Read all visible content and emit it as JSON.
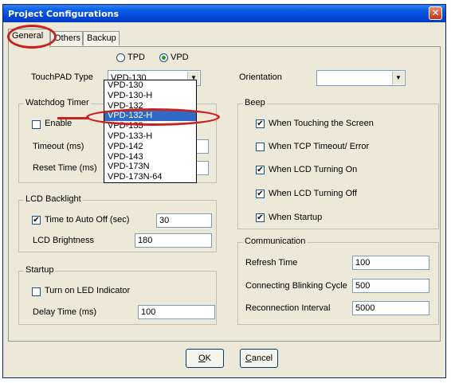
{
  "window": {
    "title": "Project Configurations",
    "close_glyph": "✕"
  },
  "tabs": [
    {
      "label": "General"
    },
    {
      "label": "Others"
    },
    {
      "label": "Backup"
    }
  ],
  "touchpad": {
    "type_label": "TouchPAD Type",
    "radio_tpd": "TPD",
    "radio_vpd": "VPD",
    "selected_radio": "VPD",
    "combo_value": "VPD-130",
    "dropdown_items": [
      "VPD-130",
      "VPD-130-H",
      "VPD-132",
      "VPD-132-H",
      "VPD-133",
      "VPD-133-H",
      "VPD-142",
      "VPD-143",
      "VPD-173N",
      "VPD-173N-64"
    ],
    "highlighted_item": "VPD-132-H"
  },
  "orientation": {
    "label": "Orientation",
    "value": ""
  },
  "watchdog": {
    "title": "Watchdog Timer",
    "enable_label": "Enable",
    "timeout_label": "Timeout (ms)",
    "reset_label": "Reset Time (ms)"
  },
  "backlight": {
    "title": "LCD Backlight",
    "auto_off_label": "Time to Auto Off (sec)",
    "auto_off_value": "30",
    "brightness_label": "LCD Brightness",
    "brightness_value": "180"
  },
  "startup": {
    "title": "Startup",
    "led_label": "Turn on LED Indicator",
    "delay_label": "Delay Time (ms)",
    "delay_value": "100"
  },
  "beep": {
    "title": "Beep",
    "items": [
      {
        "label": "When Touching the Screen",
        "checked": true
      },
      {
        "label": "When TCP Timeout/ Error",
        "checked": false
      },
      {
        "label": "When LCD Turning On",
        "checked": true
      },
      {
        "label": "When LCD Turning Off",
        "checked": true
      },
      {
        "label": "When Startup",
        "checked": true
      }
    ]
  },
  "communication": {
    "title": "Communication",
    "refresh_label": "Refresh Time",
    "refresh_value": "100",
    "blink_label": "Connecting Blinking Cycle",
    "blink_value": "500",
    "reconnect_label": "Reconnection Interval",
    "reconnect_value": "5000"
  },
  "buttons": {
    "ok_u": "O",
    "ok_rest": "K",
    "cancel_u": "C",
    "cancel_rest": "ancel"
  },
  "check_glyph": "✔",
  "icons": {
    "dropdown": "▼"
  },
  "colors": {
    "highlight": "#316ac5",
    "annotation": "#cc1f1f",
    "titlebar": "#0a5fe8"
  }
}
